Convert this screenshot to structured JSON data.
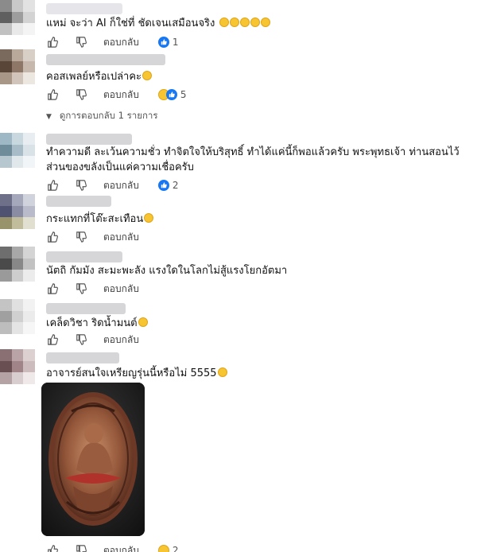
{
  "reply_label": "ตอบกลับ",
  "comments": [
    {
      "text": "แหม่ จะว่า AI ก็ใช่ที่ ชัดเจนเสมือนจริง",
      "emoji_count": 5,
      "reaction_count": "1",
      "reaction": "like"
    },
    {
      "text": "คอสเพลย์หรือเปล่าคะ",
      "emoji_count": 1,
      "reaction_count": "5",
      "reaction": "haha-like",
      "view_replies": "ดูการตอบกลับ 1 รายการ"
    },
    {
      "text": "ทำความดี ละเว้นความชั่ว ทำจิตใจให้บริสุทธิ์ ทำได้แค่นี้ก็พอแล้วครับ พระพุทธเจ้า ท่านสอนไว้ ส่วนของขลังเป็นแค่ความเชื่อครับ",
      "emoji_count": 0,
      "reaction_count": "2",
      "reaction": "like"
    },
    {
      "text": "กระแทกที่โต๊ะสะเทือน",
      "emoji_count": 1,
      "reaction_count": "",
      "reaction": "none"
    },
    {
      "text": "นัตถิ กัมมัง สะมะพะลัง แรงใดในโลกไม่สู้แรงโยกอัตมา",
      "emoji_count": 0,
      "reaction_count": "",
      "reaction": "none"
    },
    {
      "text": "เคล็ดวิชา ริดน้ำมนต์",
      "emoji_count": 1,
      "reaction_count": "",
      "reaction": "none"
    },
    {
      "text": "อาจารย์สนใจเหรียญรุ่นนี้หรือไม่ 5555",
      "emoji_count": 1,
      "reaction_count": "2",
      "reaction": "haha",
      "has_photo": true
    }
  ],
  "photo": {
    "icon": "amulet-medallion-photo"
  },
  "colors": {
    "like_blue": "#1877f2",
    "haha_yellow": "#f7c531",
    "text": "#050505",
    "muted": "#65676b"
  }
}
